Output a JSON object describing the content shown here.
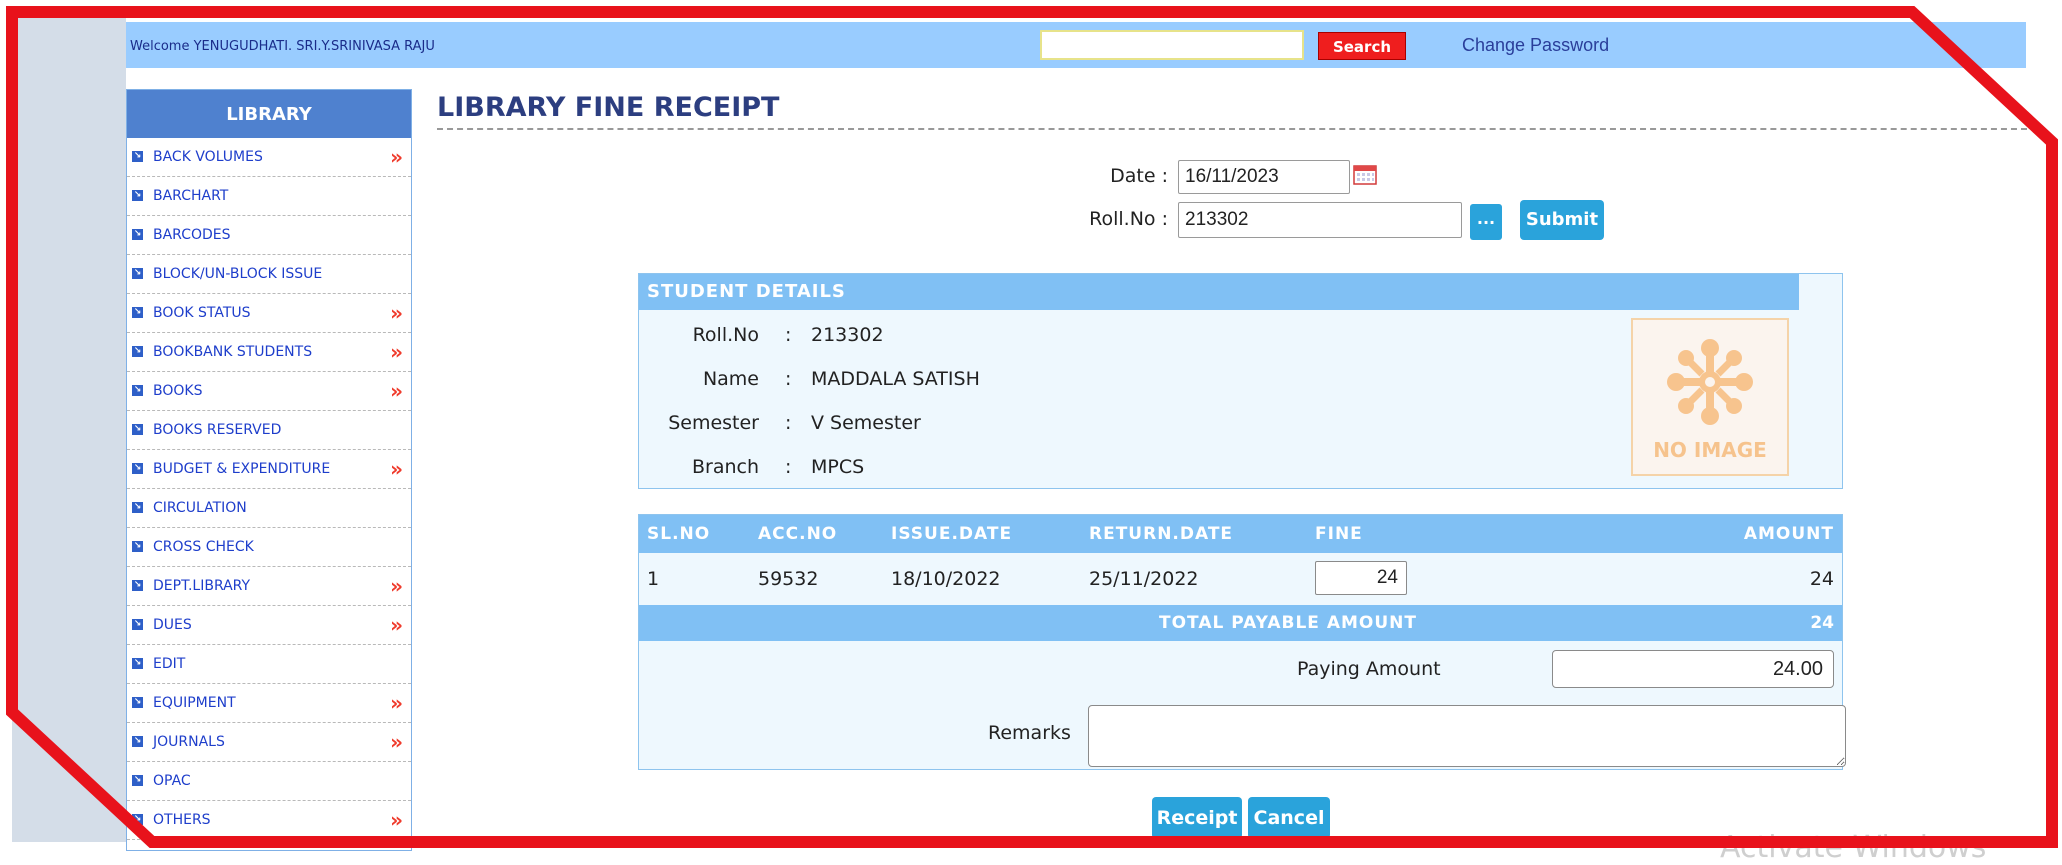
{
  "colors": {
    "topbar": "#99ccff",
    "sidebar_header": "#4f81cf",
    "section_header": "#80c0f4",
    "button": "#2aa3db",
    "search_button": "#ef1e1e",
    "annotation_frame": "#e8121b"
  },
  "header": {
    "welcome": "Welcome YENUGUDHATI. SRI.Y.SRINIVASA RAJU",
    "search_value": "",
    "search_button": "Search",
    "change_password": "Change Password"
  },
  "sidebar": {
    "title": "LIBRARY",
    "items": [
      {
        "label": "BACK VOLUMES",
        "has_submenu": true
      },
      {
        "label": "BARCHART",
        "has_submenu": false
      },
      {
        "label": "BARCODES",
        "has_submenu": false
      },
      {
        "label": "BLOCK/UN-BLOCK ISSUE",
        "has_submenu": false
      },
      {
        "label": "BOOK STATUS",
        "has_submenu": true
      },
      {
        "label": "BOOKBANK STUDENTS",
        "has_submenu": true
      },
      {
        "label": "BOOKS",
        "has_submenu": true
      },
      {
        "label": "BOOKS RESERVED",
        "has_submenu": false
      },
      {
        "label": "BUDGET & EXPENDITURE",
        "has_submenu": true
      },
      {
        "label": "CIRCULATION",
        "has_submenu": false
      },
      {
        "label": "CROSS CHECK",
        "has_submenu": false
      },
      {
        "label": "DEPT.LIBRARY",
        "has_submenu": true
      },
      {
        "label": "DUES",
        "has_submenu": true
      },
      {
        "label": "EDIT",
        "has_submenu": false
      },
      {
        "label": "EQUIPMENT",
        "has_submenu": true
      },
      {
        "label": "JOURNALS",
        "has_submenu": true
      },
      {
        "label": "OPAC",
        "has_submenu": false
      },
      {
        "label": "OTHERS",
        "has_submenu": true
      }
    ],
    "submenu_glyph": "»"
  },
  "page": {
    "title": "LIBRARY FINE RECEIPT"
  },
  "form": {
    "date_label": "Date :",
    "date_value": "16/11/2023",
    "roll_label": "Roll.No :",
    "roll_value": "213302",
    "lookup_button": "...",
    "submit_button": "Submit"
  },
  "student": {
    "section_title": "STUDENT DETAILS",
    "fields": [
      {
        "label": "Roll.No",
        "value": "213302"
      },
      {
        "label": "Name",
        "value": "MADDALA SATISH"
      },
      {
        "label": "Semester",
        "value": "V Semester"
      },
      {
        "label": "Branch",
        "value": "MPCS"
      }
    ],
    "separator": ":",
    "photo_placeholder": "NO IMAGE"
  },
  "fines": {
    "columns": [
      "SL.NO",
      "ACC.NO",
      "ISSUE.DATE",
      "RETURN.DATE",
      "FINE",
      "AMOUNT"
    ],
    "rows": [
      {
        "sl_no": "1",
        "acc_no": "59532",
        "issue_date": "18/10/2022",
        "return_date": "25/11/2022",
        "fine": "24",
        "amount": "24"
      }
    ],
    "total_label": "TOTAL PAYABLE AMOUNT",
    "total_value": "24",
    "paying_label": "Paying Amount",
    "paying_value": "24.00",
    "remarks_label": "Remarks",
    "remarks_value": ""
  },
  "actions": {
    "receipt": "Receipt",
    "cancel": "Cancel"
  },
  "watermark": "Activate Windows"
}
